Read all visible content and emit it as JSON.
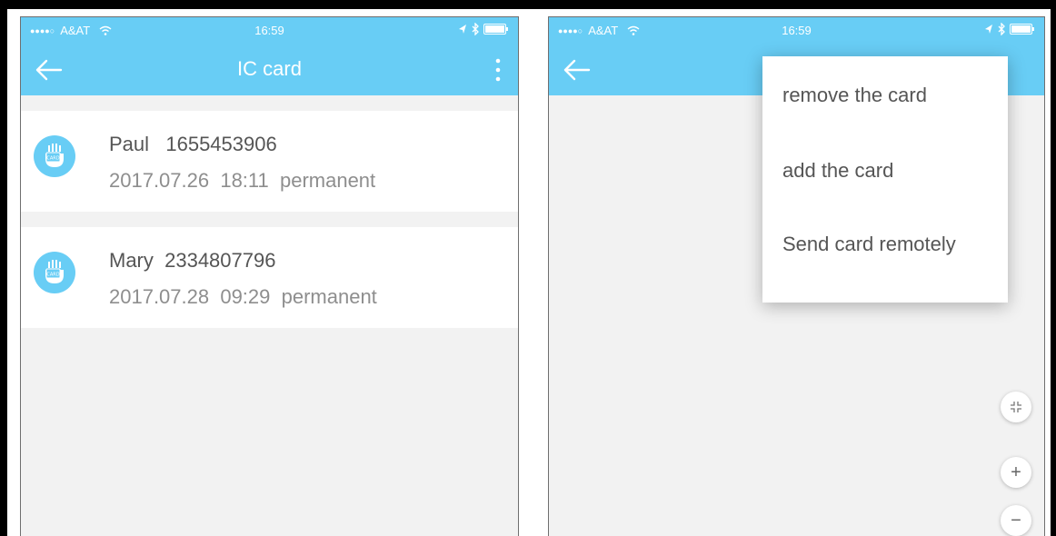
{
  "status": {
    "signal": "●●●●○",
    "carrier": "A&AT",
    "time": "16:59"
  },
  "left_screen": {
    "title": "IC card",
    "cards": [
      {
        "name": "Paul   1655453906",
        "meta": "2017.07.26  18:11  permanent"
      },
      {
        "name": "Mary  2334807796",
        "meta": "2017.07.28  09:29  permanent"
      }
    ]
  },
  "right_screen": {
    "menu": [
      {
        "label": "remove the card"
      },
      {
        "label": "add the card"
      },
      {
        "label": "Send card remotely"
      }
    ],
    "controls": {
      "zoom_in": "+",
      "zoom_out": "−"
    }
  },
  "icons": {
    "back": "arrow-left-icon",
    "more": "more-vertical-icon",
    "card": "card-icon",
    "wifi": "wifi-icon",
    "battery": "battery-icon",
    "bluetooth": "bluetooth-icon",
    "location": "location-arrow-icon",
    "shrink": "shrink-icon"
  },
  "colors": {
    "accent": "#68cdf5",
    "background": "#f2f2f2",
    "primary_text": "#555555",
    "secondary_text": "#8e8e8e"
  }
}
